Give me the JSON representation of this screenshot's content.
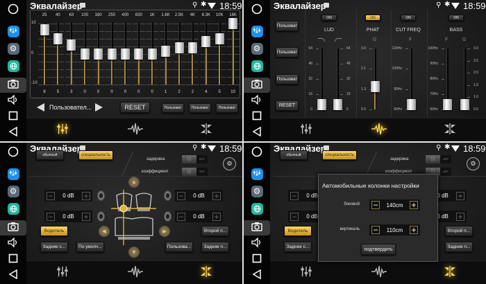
{
  "status": {
    "title": "Эквалайзер",
    "time": "18:59"
  },
  "sidebar": {
    "items": [
      "home-circle",
      "equalizer-app",
      "settings-app",
      "browser-app",
      "screenshot",
      "volume",
      "recent-apps",
      "back"
    ]
  },
  "bottom_tabs": [
    "equalizer-tab",
    "sound-effects-tab",
    "speaker-position-tab"
  ],
  "panels_active_tab": [
    0,
    1,
    2,
    2
  ],
  "eq": {
    "scale": [
      "10",
      "0",
      "-10"
    ],
    "bands": [
      {
        "freq": "25",
        "value": "8"
      },
      {
        "freq": "40",
        "value": "5"
      },
      {
        "freq": "63",
        "value": "3"
      },
      {
        "freq": "100",
        "value": "0"
      },
      {
        "freq": "160",
        "value": "0"
      },
      {
        "freq": "250",
        "value": "0"
      },
      {
        "freq": "400",
        "value": "0"
      },
      {
        "freq": "630",
        "value": "0"
      },
      {
        "freq": "1K",
        "value": "0"
      },
      {
        "freq": "1.6K",
        "value": "1"
      },
      {
        "freq": "2.5K",
        "value": "2"
      },
      {
        "freq": "4K",
        "value": "2"
      },
      {
        "freq": "6.3K",
        "value": "4"
      },
      {
        "freq": "10K",
        "value": "5"
      },
      {
        "freq": "16K",
        "value": "10"
      }
    ],
    "preset_label": "Пользовател...",
    "reset_label": "RESET",
    "presets": [
      "Пользоват",
      "Пользоват",
      "Пользоват"
    ]
  },
  "effects": {
    "presets": [
      "Пользоват",
      "Пользоват",
      "Пользоват"
    ],
    "reset_label": "RESET",
    "on_label": "ON",
    "lud": {
      "label": "LUD",
      "ticks": [
        "64",
        "48",
        "32",
        "16",
        "0"
      ],
      "left_value": 0,
      "right_value": 0
    },
    "phat": {
      "label": "PHAT",
      "sub": "G",
      "ticks": [
        "3.0",
        "2.1",
        "1.3",
        "0.5"
      ],
      "value_fraction": 0.33,
      "enabled": true
    },
    "cut_freq": {
      "label": "CUT FREQ",
      "sub": "F",
      "ticks": [
        "120Hz",
        "100Hz",
        "80Hz",
        "60Hz"
      ],
      "value_fraction": 0
    },
    "bass": {
      "label": "BASS",
      "sub_f": "F",
      "sub_g": "G",
      "f_ticks": [
        "100Hz",
        "90Hz",
        "80Hz",
        "70Hz",
        "60Hz"
      ],
      "g_ticks": [
        "3.0",
        "2.5",
        "2.0",
        "1.5",
        "1.0",
        "0.5"
      ],
      "f_fraction": 0,
      "g_fraction": 0
    }
  },
  "position": {
    "mode_normal": "обычный",
    "mode_special": "специальность",
    "delay_label": "задержка",
    "coef_label": "коэффициент",
    "toggle_off": "OFF",
    "levels": [
      "0 dB",
      "0 dB",
      "0 dB",
      "0 dB"
    ],
    "buttons": {
      "driver": "Водитель",
      "rear_left": "Задние с...",
      "default": "По умолч...",
      "user": "Пользова...",
      "second": "Второй п...",
      "rear_right": "Задние п..."
    }
  },
  "dialog": {
    "title": "Автомобильные колонки настройки",
    "side_label": "боковой",
    "side_value": "140cm",
    "vertical_label": "вертикаль",
    "vertical_value": "110cm",
    "confirm": "подтвердить"
  }
}
